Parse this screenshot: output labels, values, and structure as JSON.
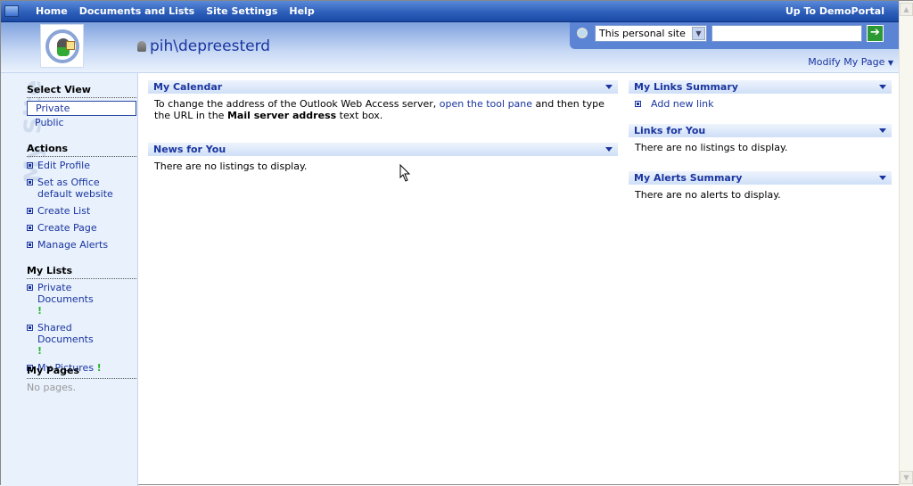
{
  "topnav": {
    "items": [
      "Home",
      "Documents and Lists",
      "Site Settings",
      "Help"
    ],
    "up_link": "Up To DemoPortal"
  },
  "header": {
    "username": "pih\\depreesterd",
    "modify_label": "Modify My Page",
    "search": {
      "scope": "This personal site",
      "query": ""
    }
  },
  "sidebar": {
    "watermark": "My Site",
    "select_view": {
      "title": "Select View",
      "options": [
        "Private",
        "Public"
      ],
      "selected": "Private"
    },
    "actions": {
      "title": "Actions",
      "items": [
        "Edit Profile",
        "Set as Office default website",
        "Create List",
        "Create Page",
        "Manage Alerts"
      ]
    },
    "my_lists": {
      "title": "My Lists",
      "items": [
        "Private Documents",
        "Shared Documents",
        "My Pictures"
      ],
      "new_marker": "!"
    },
    "my_pages": {
      "title": "My Pages",
      "empty": "No pages."
    }
  },
  "webparts": {
    "calendar": {
      "title": "My Calendar",
      "text1": "To change the address of the Outlook Web Access server,",
      "link": "open the tool pane",
      "text2": "and then type the URL in the",
      "bold": "Mail server address",
      "text3": "text box."
    },
    "news": {
      "title": "News for You",
      "text": "There are no listings to display."
    },
    "links_summary": {
      "title": "My Links Summary",
      "link": "Add new link"
    },
    "links_for_you": {
      "title": "Links for You",
      "text": "There are no listings to display."
    },
    "alerts": {
      "title": "My Alerts Summary",
      "text": "There are no alerts to display."
    }
  },
  "colors": {
    "accent": "#1a35a0",
    "topbar": "#2a5cb8",
    "sidebar": "#e8f1fc"
  }
}
